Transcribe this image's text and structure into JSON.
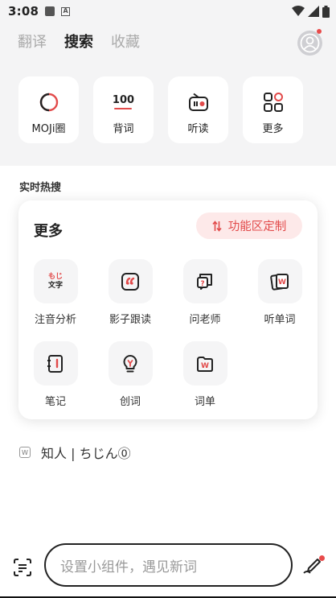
{
  "status_bar": {
    "time": "3:08"
  },
  "tabs": [
    {
      "label": "翻译",
      "active": false
    },
    {
      "label": "搜索",
      "active": true
    },
    {
      "label": "收藏",
      "active": false
    }
  ],
  "quick_actions": [
    {
      "label": "MOJi圈",
      "icon": "moji-circle-icon"
    },
    {
      "label": "背词",
      "icon": "100-words-icon",
      "icon_text": "100"
    },
    {
      "label": "听读",
      "icon": "radio-icon"
    },
    {
      "label": "更多",
      "icon": "grid-more-icon"
    }
  ],
  "hot_search": {
    "title": "实时热搜",
    "items": [
      {
        "text": "知人 | ちじん⓪"
      }
    ]
  },
  "more_panel": {
    "title": "更多",
    "customize_label": "功能区定制",
    "items": [
      {
        "label": "注音分析",
        "icon": "furigana-icon",
        "icon_line1": "もじ",
        "icon_line2": "文字"
      },
      {
        "label": "影子跟读",
        "icon": "shadowing-quote-icon"
      },
      {
        "label": "问老师",
        "icon": "ask-teacher-icon"
      },
      {
        "label": "听单词",
        "icon": "listen-words-icon"
      },
      {
        "label": "笔记",
        "icon": "notebook-icon"
      },
      {
        "label": "创词",
        "icon": "create-word-icon"
      },
      {
        "label": "词单",
        "icon": "word-list-icon"
      }
    ]
  },
  "widget_input": {
    "placeholder": "设置小组件，遇见新词"
  },
  "colors": {
    "accent": "#e24a4a",
    "accent_bg": "#fde9e9"
  }
}
